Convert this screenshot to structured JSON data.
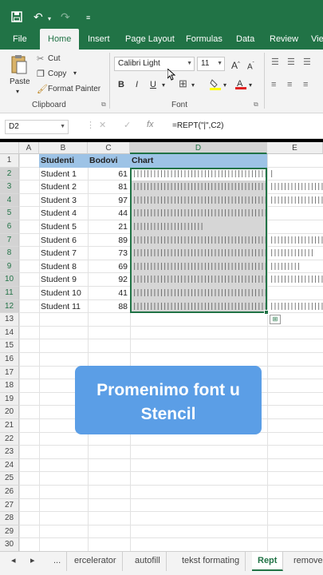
{
  "ribbon_tabs": [
    "File",
    "Home",
    "Insert",
    "Page Layout",
    "Formulas",
    "Data",
    "Review",
    "Vie"
  ],
  "clipboard": {
    "paste": "Paste",
    "cut": "Cut",
    "copy": "Copy",
    "format_painter": "Format Painter",
    "label": "Clipboard"
  },
  "font": {
    "name": "Calibri Light",
    "size": "11",
    "label": "Font",
    "bold": "B",
    "italic": "I",
    "underline": "U"
  },
  "formula_bar": {
    "name_box": "D2",
    "fx": "fx",
    "formula": "=REPT(\"|\",C2)"
  },
  "columns": [
    "A",
    "B",
    "C",
    "D",
    "E"
  ],
  "row_numbers": [
    "1",
    "2",
    "3",
    "4",
    "5",
    "6",
    "7",
    "8",
    "9",
    "10",
    "11",
    "12",
    "13",
    "14",
    "15",
    "16",
    "17",
    "18",
    "19",
    "20",
    "21",
    "22",
    "23",
    "24",
    "25",
    "26",
    "27",
    "28",
    "29",
    "30"
  ],
  "table": {
    "headers": [
      "Studenti",
      "Bodovi",
      "Chart"
    ],
    "rows": [
      {
        "name": "Student 1",
        "value": "61"
      },
      {
        "name": "Student 2",
        "value": "81"
      },
      {
        "name": "Student 3",
        "value": "97"
      },
      {
        "name": "Student 4",
        "value": "44"
      },
      {
        "name": "Student 5",
        "value": "21"
      },
      {
        "name": "Student 6",
        "value": "89"
      },
      {
        "name": "Student 7",
        "value": "73"
      },
      {
        "name": "Student 8",
        "value": "69"
      },
      {
        "name": "Student 9",
        "value": "92"
      },
      {
        "name": "Student 10",
        "value": "41"
      },
      {
        "name": "Student 11",
        "value": "88"
      }
    ]
  },
  "callout": {
    "line1": "Promenimo font u",
    "line2": "Stencil"
  },
  "sheet_tabs": {
    "ellipsis": "...",
    "tabs": [
      "ercelerator",
      "autofill",
      "tekst formating",
      "Rept",
      "remove"
    ]
  },
  "colors": {
    "excel_green": "#217346",
    "header_fill": "#9dc3e6",
    "callout_blue": "#5b9ee6"
  }
}
